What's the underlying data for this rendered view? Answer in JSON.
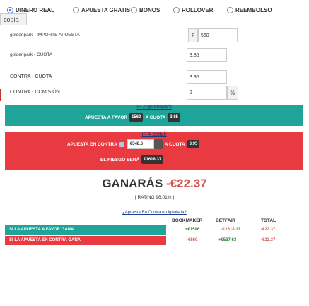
{
  "top_options": {
    "items": [
      "DINERO REAL",
      "APUESTA GRATIS",
      "BONOS",
      "ROLLOVER",
      "REEMBOLSO"
    ],
    "selected": "DINERO REAL",
    "copy_button": "copia"
  },
  "form": {
    "stake_label": "goldenpark - IMPORTE APUESTA",
    "currency_symbol": "€",
    "stake_value": "560",
    "odds_label": "goldenpark - CUOTA",
    "odds_value": "3.85",
    "lay_odds_label": "CONTRA - CUOTA",
    "lay_odds_value": "3.95",
    "commission_label": "CONTRA - COMISIÓN",
    "commission_value": "2",
    "percent_symbol": "%"
  },
  "back_bar": {
    "link": "IR A goldenpark",
    "prefix": "APUESTA A FAVOR",
    "stake": "€560",
    "at_odds": "A CUOTA",
    "odds": "3.85"
  },
  "lay_bar": {
    "link": "IR A Betfair",
    "prefix": "APUESTA EN CONTRA",
    "stake": "€548.6",
    "at_odds": "A CUOTA",
    "odds": "3.95",
    "liability_label": "EL RIESGO SERÁ",
    "liability": "€1618.37"
  },
  "result": {
    "ganaras_label": "GANARÁS",
    "ganaras_value": "-€22.37",
    "rating": "[ RATING 96.01% ]",
    "question_link": "¿Apuesta En Contra no Igualada?"
  },
  "table": {
    "headers": [
      "BOOKMAKER",
      "BETFAIR",
      "TOTAL"
    ],
    "rows": [
      {
        "label": "SI LA APUESTA A FAVOR GANA",
        "bookmaker": "+€1596",
        "betfair": "-€1618.37",
        "total": "-€22.37"
      },
      {
        "label": "SI LA APUESTA EN CONTRA GANA",
        "bookmaker": "-€560",
        "betfair": "+€537.63",
        "total": "-€22.37"
      }
    ]
  },
  "colors": {
    "teal": "#1fa49a",
    "red": "#e83a40",
    "badge": "#333333"
  }
}
